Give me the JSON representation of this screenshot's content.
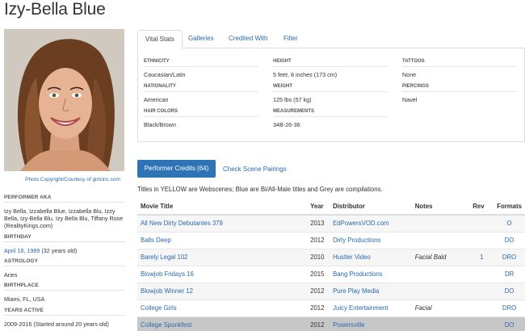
{
  "performer": {
    "name": "Izy-Bella Blue",
    "photo_credit": "Photo Copyright/Courtesy of girlzinc.com"
  },
  "sidebar": {
    "aka_label": "PERFORMER AKA",
    "aka_value": "Izy Bella, Izzabella Blue, Izzabella Blu, Izzy Bella, Izy-Bella Blu, Izy Bella Blu, Tiffany Rose (RealityKings.com)",
    "birthday_label": "BIRTHDAY",
    "birthday_date": "April 18, 1989",
    "birthday_age": "(32 years old)",
    "astrology_label": "ASTROLOGY",
    "astrology_value": "Aries",
    "birthplace_label": "BIRTHPLACE",
    "birthplace_value": "Miami, FL, USA",
    "years_active_label": "YEARS ACTIVE",
    "years_active_value": "2009-2016 (Started around 20 years old)"
  },
  "tabs": {
    "vital_stats": "Vital Stats",
    "galleries": "Galleries",
    "credited_with": "Credited With",
    "filter": "Filter"
  },
  "stats": {
    "ethnicity": {
      "label": "ETHNICITY",
      "value": "Caucasian/Latin"
    },
    "nationality": {
      "label": "NATIONALITY",
      "value": "American"
    },
    "hair": {
      "label": "HAIR COLORS",
      "value": "Black/Brown"
    },
    "height": {
      "label": "HEIGHT",
      "value": "5 feet, 8 inches (173 cm)"
    },
    "weight": {
      "label": "WEIGHT",
      "value": "125 lbs (57 kg)"
    },
    "measurements": {
      "label": "MEASUREMENTS",
      "value": "34B-26-36"
    },
    "tattoos": {
      "label": "TATTOOS",
      "value": "None"
    },
    "piercings": {
      "label": "PIERCINGS",
      "value": "Navel"
    }
  },
  "credits": {
    "button_label": "Performer Credits (64)",
    "pairings_label": "Check Scene Pairings",
    "notice": "Titles in YELLOW are Webscenes; Blue are Bi/All-Male titles and Grey are compilations.",
    "headers": {
      "title": "Movie Title",
      "year": "Year",
      "distributor": "Distributor",
      "notes": "Notes",
      "rev": "Rev",
      "formats": "Formats"
    },
    "rows": [
      {
        "title": "All New Dirty Debutantes 379",
        "year": "2013",
        "distributor": "EdPowersVOD.com",
        "notes": "",
        "rev": "",
        "formats": "O"
      },
      {
        "title": "Balls Deep",
        "year": "2012",
        "distributor": "Dirty Productions",
        "notes": "",
        "rev": "",
        "formats": "DO"
      },
      {
        "title": "Barely Legal 102",
        "year": "2010",
        "distributor": "Hustler Video",
        "notes": "Facial Bald",
        "rev": "1",
        "formats": "DRO"
      },
      {
        "title": "Blowjob Fridays 16",
        "year": "2015",
        "distributor": "Bang Productions",
        "notes": "",
        "rev": "",
        "formats": "DR"
      },
      {
        "title": "Blowjob Winner 12",
        "year": "2012",
        "distributor": "Pure Play Media",
        "notes": "",
        "rev": "",
        "formats": "DO"
      },
      {
        "title": "College Girls",
        "year": "2012",
        "distributor": "Juicy Entertainment",
        "notes": "Facial",
        "rev": "",
        "formats": "DRO"
      },
      {
        "title": "College Spunkfest",
        "year": "2012",
        "distributor": "Powersville",
        "notes": "",
        "rev": "",
        "formats": "DO"
      }
    ]
  }
}
